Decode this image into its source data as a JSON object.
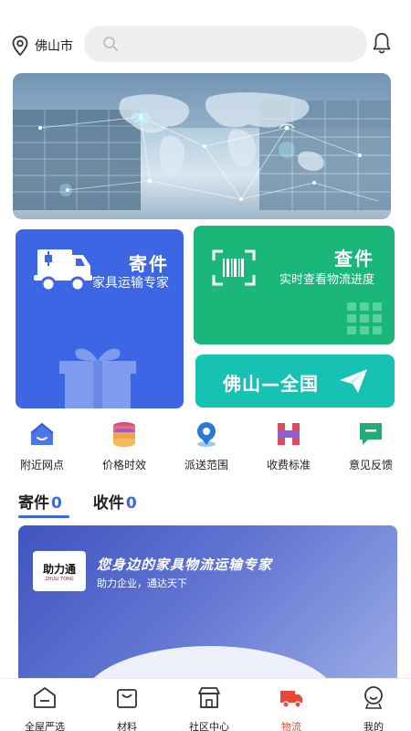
{
  "header": {
    "city": "佛山市",
    "search_placeholder": ""
  },
  "cards": {
    "send": {
      "title": "寄件",
      "subtitle": "家具运输专家"
    },
    "query": {
      "title": "查件",
      "subtitle": "实时查看物流进度"
    },
    "route": {
      "title": "佛山—全国"
    }
  },
  "nav": [
    {
      "label": "附近网点",
      "icon": "home-icon"
    },
    {
      "label": "价格时效",
      "icon": "database-icon"
    },
    {
      "label": "派送范围",
      "icon": "location-icon"
    },
    {
      "label": "收费标准",
      "icon": "h-grid-icon"
    },
    {
      "label": "意见反馈",
      "icon": "chat-icon"
    }
  ],
  "tabs": [
    {
      "label": "寄件",
      "count": "0"
    },
    {
      "label": "收件",
      "count": "0"
    }
  ],
  "promo": {
    "logo_text": "助力通",
    "logo_sub": "ZHULI TONG",
    "headline": "您身边的家具物流运输专家",
    "subline": "助力企业，通达天下"
  },
  "tabbar": [
    {
      "label": "全屋严选",
      "icon": "house-icon"
    },
    {
      "label": "材料",
      "icon": "bag-icon"
    },
    {
      "label": "社区中心",
      "icon": "shop-icon"
    },
    {
      "label": "物流",
      "icon": "truck-icon"
    },
    {
      "label": "我的",
      "icon": "user-face-icon"
    }
  ],
  "colors": {
    "send_card": "#3c66e3",
    "query_card": "#1bb77a",
    "route_card": "#15c2b4",
    "active_tab_text": "#e8473a",
    "accent": "#3c66e3"
  }
}
